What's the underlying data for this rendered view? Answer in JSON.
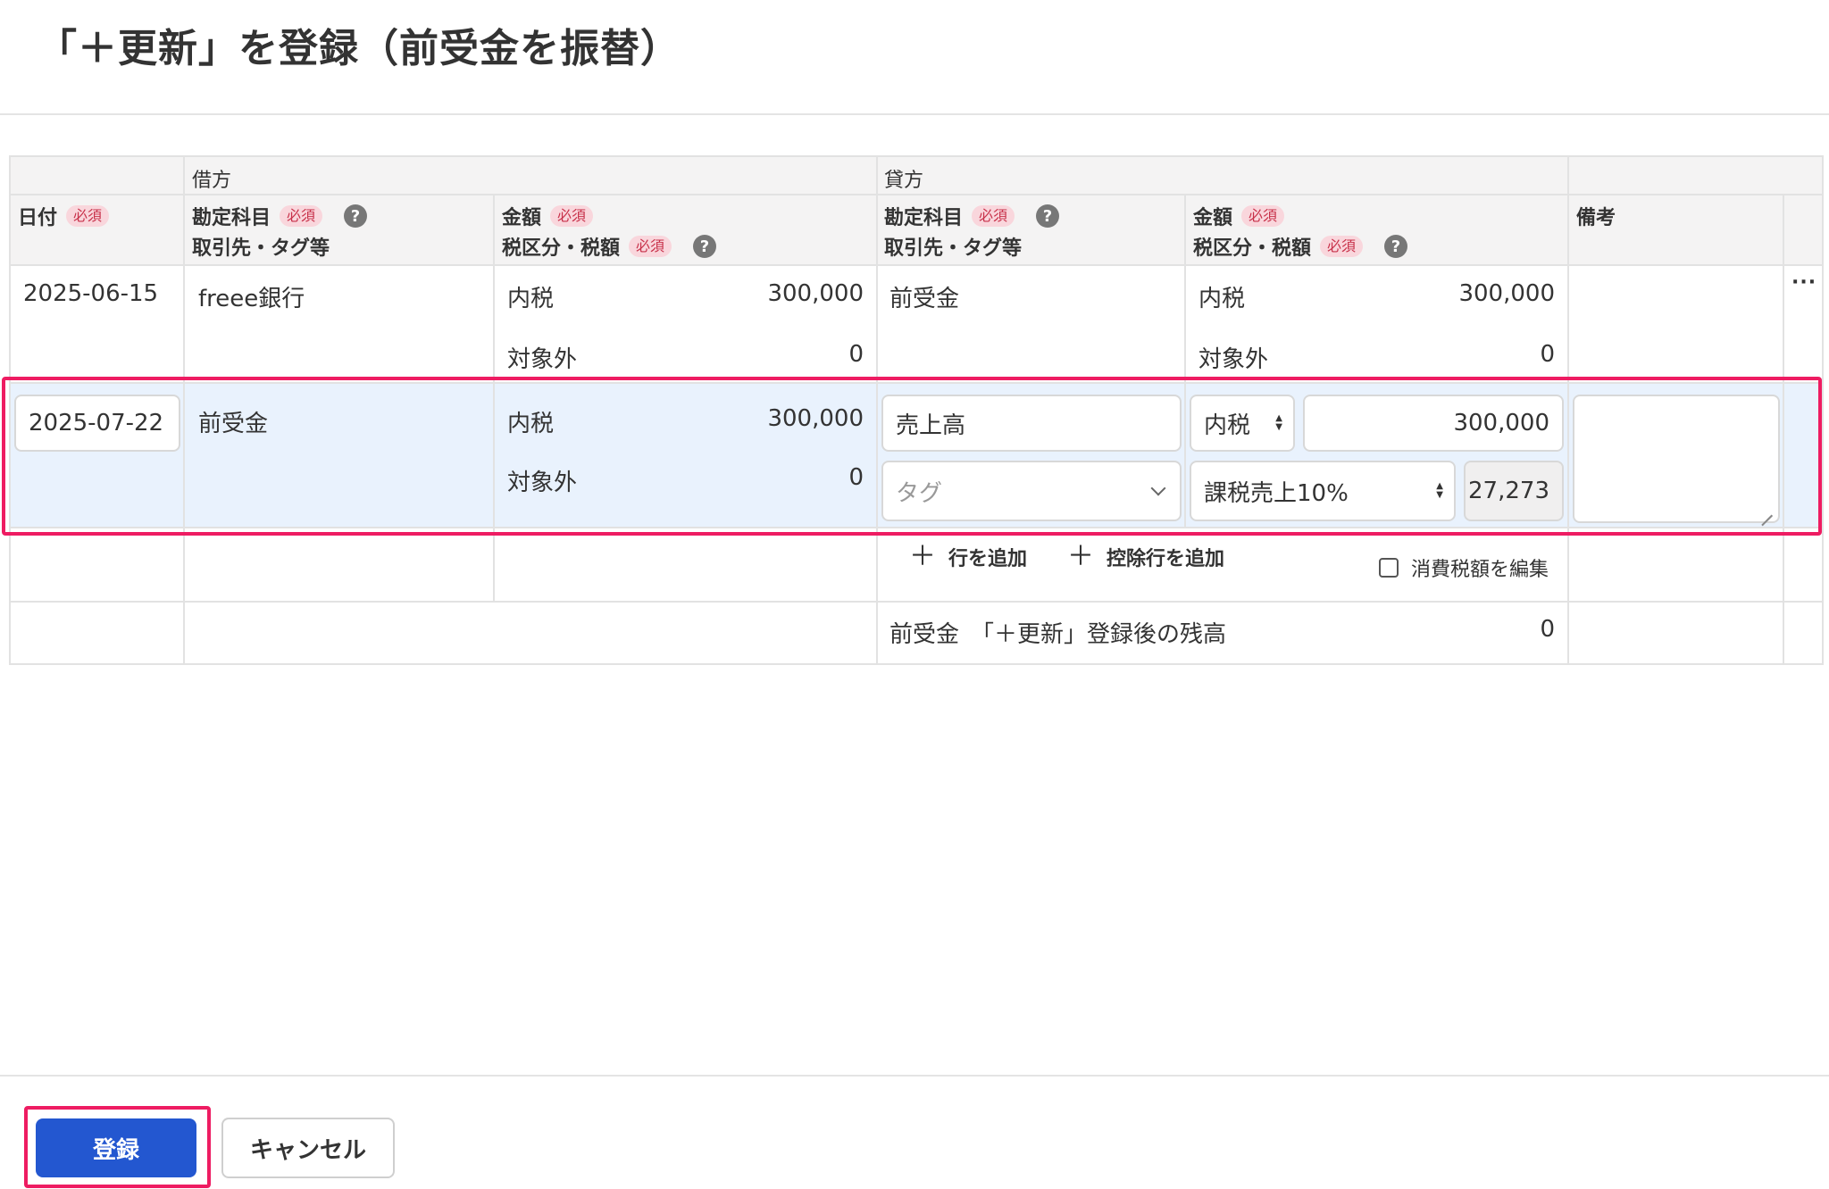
{
  "page": {
    "title": "「＋更新」を登録（前受金を振替）"
  },
  "table": {
    "group_headers": {
      "debit": "借方",
      "credit": "貸方"
    },
    "column_headers": {
      "date": "日付",
      "debit_account": "勘定科目",
      "debit_partner": "取引先・タグ等",
      "debit_amount": "金額",
      "debit_tax": "税区分・税額",
      "credit_account": "勘定科目",
      "credit_partner": "取引先・タグ等",
      "credit_amount": "金額",
      "credit_tax": "税区分・税額",
      "memo": "備考"
    },
    "required_label": "必須",
    "help_glyph": "?",
    "row1": {
      "date": "2025-06-15",
      "debit_account": "freee銀行",
      "debit_tax_type": "内税",
      "debit_amount": "300,000",
      "debit_tax_sub": "対象外",
      "debit_tax_amount": "0",
      "credit_account": "前受金",
      "credit_tax_type": "内税",
      "credit_amount": "300,000",
      "credit_tax_sub": "対象外",
      "credit_tax_amount": "0",
      "more_glyph": "···"
    },
    "row2": {
      "date": "2025-07-22",
      "debit_account": "前受金",
      "debit_tax_type": "内税",
      "debit_amount": "300,000",
      "debit_tax_sub": "対象外",
      "debit_tax_amount": "0",
      "credit_account_value": "売上高",
      "credit_tag_placeholder": "タグ",
      "credit_tax_type_value": "内税",
      "credit_amount_value": "300,000",
      "credit_tax_category_value": "課税売上10%",
      "credit_tax_amount_value": "27,273",
      "memo_value": ""
    },
    "actions": {
      "add_row": "行を追加",
      "add_deduction_row": "控除行を追加",
      "edit_tax_checkbox": "消費税額を編集",
      "plus_glyph": "＋"
    },
    "balance": {
      "label": "前受金　「＋更新」登録後の残高",
      "value": "0"
    }
  },
  "footer": {
    "submit_label": "登録",
    "cancel_label": "キャンセル"
  },
  "colors": {
    "primary": "#2357d0",
    "highlight": "#ee1c62",
    "edit_row_bg": "#e9f2fd",
    "required_badge_bg": "#f9d6dc",
    "required_badge_text": "#c8314a"
  }
}
